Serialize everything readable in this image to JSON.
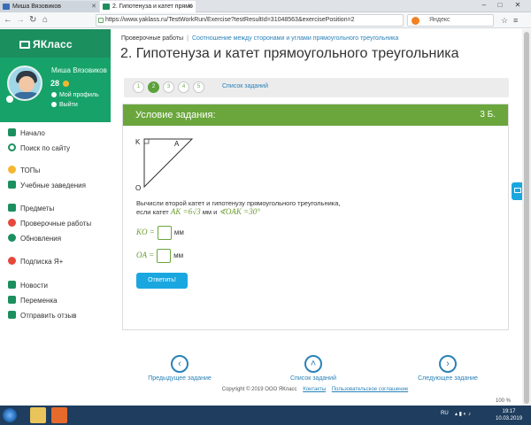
{
  "browser": {
    "tabs": [
      {
        "title": "Миша Вязовиков"
      },
      {
        "title": "2. Гипотенуза и катет прямо"
      }
    ],
    "url": "https://www.yaklass.ru/TestWorkRun/Exercise?testResultId=31048563&exercisePosition=2",
    "search_placeholder": "Яндекс",
    "window_controls": [
      "‒",
      "□",
      "✕"
    ]
  },
  "sidebar": {
    "logo": "ЯКласс",
    "user": {
      "name": "Миша Вязовиков",
      "points": "28",
      "links": [
        "Мой профиль",
        "Выйти"
      ]
    },
    "menu": [
      {
        "label": "Начало",
        "icon": "home-icon",
        "color": "#1c8f5f"
      },
      {
        "label": "Поиск по сайту",
        "icon": "search-icon",
        "color": "#1c8f5f"
      },
      {
        "label": "ТОПы",
        "icon": "star-icon",
        "color": "#f5b731"
      },
      {
        "label": "Учебные заведения",
        "icon": "school-icon",
        "color": "#1c8f5f"
      },
      {
        "label": "Предметы",
        "icon": "books-icon",
        "color": "#1c8f5f"
      },
      {
        "label": "Проверочные работы",
        "icon": "test-icon",
        "color": "#e5483c"
      },
      {
        "label": "Обновления",
        "icon": "refresh-icon",
        "color": "#1c8f5f"
      },
      {
        "label": "Подписка Я+",
        "icon": "subscription-icon",
        "color": "#e5483c"
      },
      {
        "label": "Новости",
        "icon": "megaphone-icon",
        "color": "#1c8f5f"
      },
      {
        "label": "Переменка",
        "icon": "gamepad-icon",
        "color": "#1c8f5f"
      },
      {
        "label": "Отправить отзыв",
        "icon": "chat-icon",
        "color": "#1c8f5f"
      }
    ]
  },
  "main": {
    "breadcrumb": {
      "root": "Проверочные работы",
      "current": "Соотношение между сторонами и углами прямоугольного треугольника"
    },
    "title": "2. Гипотенуза и катет прямоугольного треугольника",
    "questions": [
      "1",
      "2",
      "3",
      "4",
      "5"
    ],
    "current_question": "2",
    "question_list_link": "Список заданий",
    "card": {
      "header": "Условие задания:",
      "points": "3 Б.",
      "triangle_labels": {
        "k": "K",
        "a": "A",
        "o": "O"
      },
      "task_line1": "Вычисли второй катет и гипотенузу прямоугольного треугольника,",
      "task_line2_prefix": "если катет",
      "task_math1": "AK =6√3",
      "task_line2_mid": "мм и",
      "task_math2": "∢OAK =30°",
      "answers": [
        {
          "label": "KO =",
          "unit": "мм",
          "value": ""
        },
        {
          "label": "OA =",
          "unit": "мм",
          "value": ""
        }
      ],
      "submit": "Ответить!"
    },
    "nav": {
      "prev": "Предыдущее задание",
      "list": "Список заданий",
      "next": "Следующее задание"
    }
  },
  "footer": {
    "copyright": "Copyright © 2019 ООО ЯКласс",
    "links": [
      "Контакты",
      "Пользовательское соглашение"
    ]
  },
  "taskbar": {
    "lang": "RU",
    "time": "19:17",
    "date": "10.03.2019",
    "zoom": "100 %"
  },
  "colors": {
    "brand_green": "#1c8f5f",
    "card_header": "#6aa63c",
    "link_blue": "#2a82b8",
    "button_blue": "#1aa7e0"
  }
}
